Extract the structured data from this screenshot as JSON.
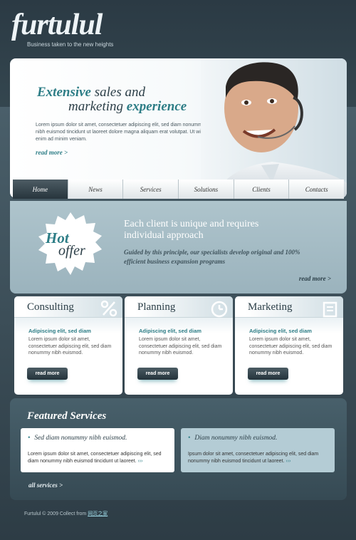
{
  "colors": {
    "accent": "#2d7d86",
    "dark": "#2c3f48",
    "page_bg": "#3b4c57",
    "offer_bg": "#a9bfc8"
  },
  "header": {
    "logo": "furtulul",
    "tagline": "Business taken to the new heights"
  },
  "hero": {
    "title_em1": "Extensive",
    "title_rest1": " sales and",
    "title_rest2": "marketing ",
    "title_em2": "experience",
    "text": "Lorem ipsum dolor sit amet, consectetuer adipiscing elit, sed diam nonummy nibh euismod tincidunt ut laoreet dolore magna aliquam erat volutpat. Ut wisi enim ad minim veniam.",
    "more": "read more >"
  },
  "nav": [
    "Home",
    "News",
    "Services",
    "Solutions",
    "Clients",
    "Contacts"
  ],
  "offer": {
    "badge_1": "Hot",
    "badge_2": "offer",
    "title": "Each client is unique and requires individual approach",
    "text": "Guided by this principle, our specialists develop original and 100% efficient business expansion programs",
    "more": "read more >"
  },
  "boxes": [
    {
      "title": "Consulting",
      "icon": "percent-icon",
      "subtitle": "Adipiscing elit, sed diam",
      "text": "Lorem ipsum dolor sit amet, consectetuer adipiscing elit, sed diam nonummy nibh euismod.",
      "button": "read more"
    },
    {
      "title": "Planning",
      "icon": "clock-icon",
      "subtitle": "Adipiscing elit, sed diam",
      "text": "Lorem ipsum dolor sit amet, consectetuer adipiscing elit, sed diam nonummy nibh euismod.",
      "button": "read more"
    },
    {
      "title": "Marketing",
      "icon": "document-icon",
      "subtitle": "Adipiscing elit, sed diam",
      "text": "Lorem ipsum dolor sit amet, consectetuer adipiscing elit, sed diam nonummy nibh euismod.",
      "button": "read more"
    }
  ],
  "featured": {
    "title": "Featured Services",
    "cards": [
      {
        "title": "Sed diam nonummy nibh euismod.",
        "text": "Lorem ipsum dolor sit amet, consectetuer adipiscing elit, sed diam nonummy nibh euismod tincidunt ut laoreet.",
        "arrow": "›››"
      },
      {
        "title": "Diam nonummy nibh euismod.",
        "text": "Ipsum dolor sit amet, consectetuer adipiscing elit, sed diam nonummy nibh euismod tincidunt ut laoreet.",
        "arrow": "›››"
      }
    ],
    "all": "all services >"
  },
  "footer": {
    "text": "Furtulul © 2009 Collect from ",
    "link": "网页之家"
  }
}
